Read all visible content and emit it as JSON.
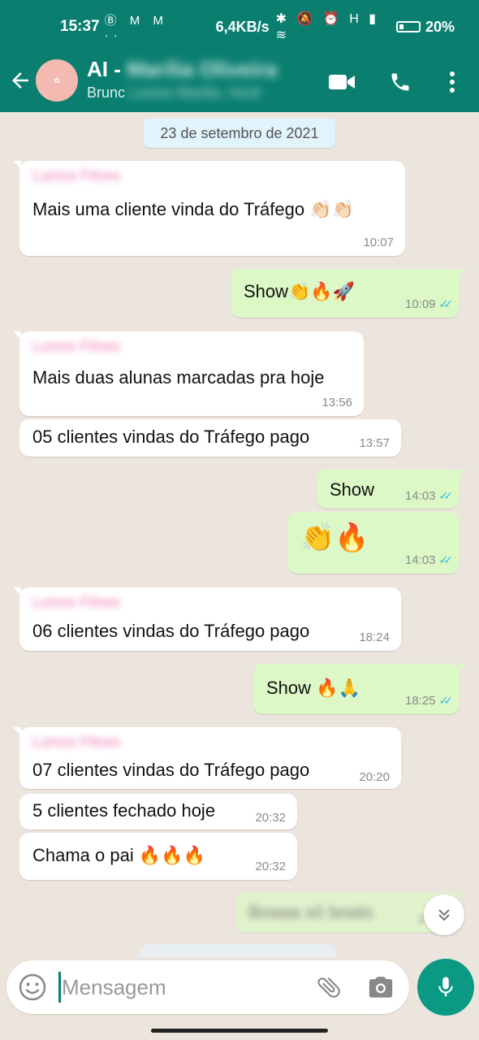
{
  "status_bar": {
    "time": "15:37",
    "left_icons": "Ⓑ M M ··",
    "network_rate": "6,4KB/s",
    "right_icons": "✱ 🔕 ⏰ H ▮ ≋",
    "battery": "20%"
  },
  "app_bar": {
    "contact_name_visible": "AI -",
    "contact_name_hidden": "Marilia Oliveira",
    "subtitle_visible": "Brunc",
    "subtitle_hidden": "Lumos Marilia, Você",
    "accent_color": "#0a7f70"
  },
  "chat": {
    "date_label": "23 de setembro de 2021",
    "messages": [
      {
        "direction": "in",
        "sender": "Lumos Fitnes",
        "text": "Mais uma cliente vinda do Tráfego 👏🏻👏🏻",
        "time": "10:07"
      },
      {
        "direction": "out",
        "text": "Show👏🔥🚀",
        "time": "10:09",
        "read": "✓✓"
      },
      {
        "direction": "in",
        "sender": "Lumos Fitnes",
        "text": "Mais duas alunas marcadas pra hoje",
        "time": "13:56"
      },
      {
        "direction": "in",
        "text": "05 clientes vindas do Tráfego pago",
        "time": "13:57"
      },
      {
        "direction": "out",
        "text": "Show",
        "time": "14:03",
        "read": "✓✓"
      },
      {
        "direction": "out",
        "text": "👏🔥",
        "time": "14:03",
        "read": "✓✓"
      },
      {
        "direction": "in",
        "sender": "Lumos Fitnes",
        "text": "06 clientes vindas do Tráfego pago",
        "time": "18:24"
      },
      {
        "direction": "out",
        "text": "Show 🔥🙏",
        "time": "18:25",
        "read": "✓✓"
      },
      {
        "direction": "in",
        "sender": "Lumos Fitnes",
        "text": "07 clientes vindas do Tráfego pago",
        "time": "20:20"
      },
      {
        "direction": "in",
        "text": "5 clientes fechado hoje",
        "time": "20:32"
      },
      {
        "direction": "in",
        "text": "Chama o pai 🔥🔥🔥",
        "time": "20:32"
      },
      {
        "direction": "out",
        "text": "Boaaa só boato",
        "time": "20:36"
      }
    ]
  },
  "composer": {
    "placeholder": "Mensagem"
  },
  "icons": {
    "back": "arrow-left",
    "video": "video-camera",
    "call": "phone",
    "menu": "more-vert",
    "emoji": "smiley",
    "attach": "paperclip",
    "camera": "camera",
    "mic": "microphone",
    "scroll": "double-chevron-down"
  }
}
